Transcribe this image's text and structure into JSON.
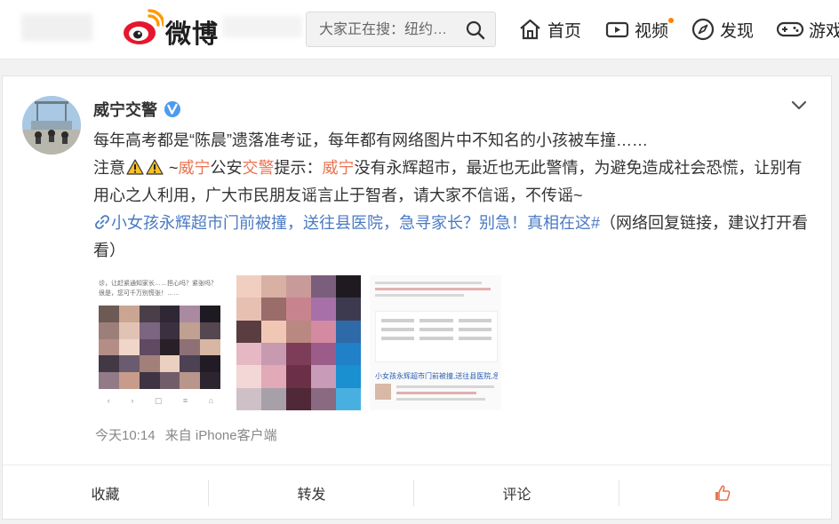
{
  "header": {
    "logo_text": "微博",
    "search_placeholder": "大家正在搜：纽约…",
    "nav": [
      {
        "label": "首页",
        "icon": "home-icon"
      },
      {
        "label": "视频",
        "icon": "video-icon"
      },
      {
        "label": "发现",
        "icon": "compass-icon"
      },
      {
        "label": "游戏",
        "icon": "gamepad-icon"
      }
    ]
  },
  "post": {
    "author": "威宁交警",
    "line1": "每年高考都是“陈晨”遗落准考证，每年都有网络图片中不知名的小孩被车撞……",
    "p2_a": "注意",
    "p2_b": "~",
    "p2_c": "威宁",
    "p2_d": "公安",
    "p2_e": "交警",
    "p2_f": "提示：",
    "p2_g": "威宁",
    "p2_h": "没有永辉超市，最近也无此警情，为避免造成社会恐慌，让别有用心之人利用，广大市民朋友谣言止于智者，请大家不信谣，不传谣~",
    "link_text": "小女孩永辉超市门前被撞，送往县医院，急寻家长？别急！真相在这#",
    "after_link": "（网络回复链接，建议打开看看）",
    "thumb1_caption": "诊，让赶紧通知家长……担心吗？紧张吗？很是，您可千万别慌张！……",
    "thumb3_headline": "小女孩永辉超市门前被撞,送往县医院,急…",
    "time": "今天10:14",
    "source": "来自 iPhone客户端"
  },
  "actions": {
    "collect": "收藏",
    "repost": "转发",
    "comment": "评论"
  },
  "colors": {
    "accent": "#ff8200",
    "highlight": "#eb7350",
    "link": "#4a7ac4",
    "verified": "#4d9bf0"
  }
}
